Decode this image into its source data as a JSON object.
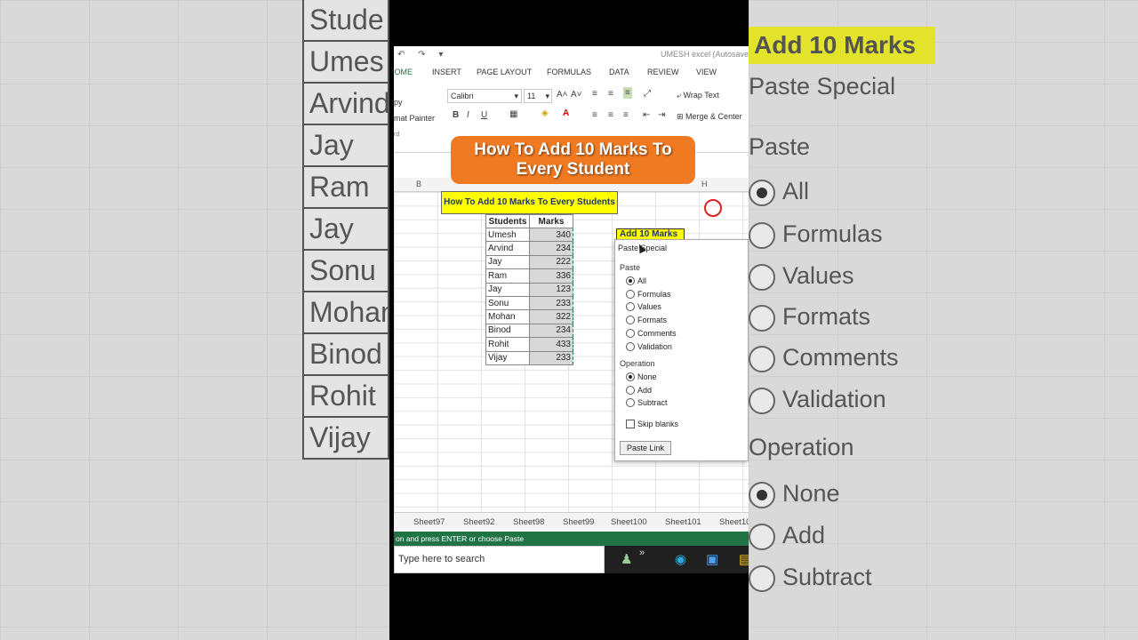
{
  "overlay_title": "How To Add 10 Marks To Every Student",
  "background_left": {
    "header": "Stude",
    "names": [
      "Umes",
      "Arvind",
      "Jay",
      "Ram",
      "Jay",
      "Sonu",
      "Mohan",
      "Binod",
      "Rohit",
      "Vijay"
    ]
  },
  "background_right": {
    "header": "Add 10 Marks",
    "paste_special": "Paste Special",
    "paste": "Paste",
    "options": [
      "All",
      "Formulas",
      "Values",
      "Formats",
      "Comments",
      "Validation"
    ],
    "operation": "Operation",
    "op_options": [
      "None",
      "Add",
      "Subtract"
    ]
  },
  "excel": {
    "window_title": "UMESH excel (Autosave",
    "tabs": [
      "HOME",
      "INSERT",
      "PAGE LAYOUT",
      "FORMULAS",
      "DATA",
      "REVIEW",
      "VIEW"
    ],
    "font_name": "Calibri",
    "font_size": "11",
    "wrap_text": "Wrap Text",
    "merge_center": "Merge & Center",
    "copy": "py",
    "format_painter": "mat Painter",
    "clipboard": "rd",
    "bold": "B",
    "italic": "I",
    "underline": "U",
    "col_b": "B",
    "col_h": "H",
    "banner": "How To Add 10 Marks To Every Students",
    "table_headers": [
      "Students",
      "Marks"
    ],
    "rows": [
      {
        "name": "Umesh",
        "mark": "340"
      },
      {
        "name": "Arvind",
        "mark": "234"
      },
      {
        "name": "Jay",
        "mark": "222"
      },
      {
        "name": "Ram",
        "mark": "336"
      },
      {
        "name": "Jay",
        "mark": "123"
      },
      {
        "name": "Sonu",
        "mark": "233"
      },
      {
        "name": "Mohan",
        "mark": "322"
      },
      {
        "name": "Binod",
        "mark": "234"
      },
      {
        "name": "Rohit",
        "mark": "433"
      },
      {
        "name": "Vijay",
        "mark": "233"
      }
    ],
    "add_label": "Add  10 Marks",
    "dialog": {
      "title": "Paste Special",
      "paste_section": "Paste",
      "paste_options": [
        "All",
        "Formulas",
        "Values",
        "Formats",
        "Comments",
        "Validation"
      ],
      "paste_selected": "All",
      "operation_section": "Operation",
      "operation_options": [
        "None",
        "Add",
        "Subtract"
      ],
      "operation_selected": "None",
      "skip_blanks": "Skip blanks",
      "paste_link": "Paste Link"
    },
    "sheet_tabs": [
      "Sheet97",
      "Sheet92",
      "Sheet98",
      "Sheet99",
      "Sheet100",
      "Sheet101",
      "Sheet10"
    ],
    "status_text": "on and press ENTER or choose Paste",
    "taskbar_search": "Type here to search"
  },
  "colors": {
    "accent": "#217346",
    "overlay": "#f07a22",
    "highlight": "#ffff00",
    "circle": "#e02020"
  }
}
